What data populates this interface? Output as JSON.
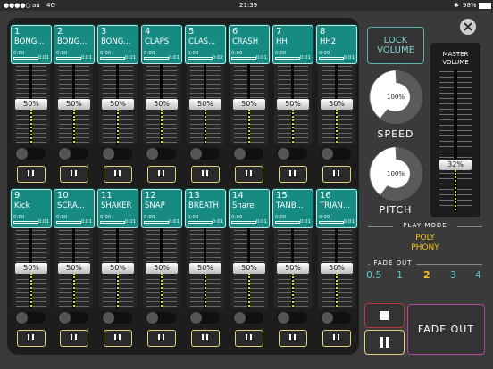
{
  "status": {
    "carrier": "au",
    "network": "4G",
    "time": "21:39",
    "battery": "98%"
  },
  "channels": [
    {
      "num": "1",
      "name": "BONG...",
      "pos": "0:00",
      "len": "0:01",
      "level": "50%",
      "level_frac": 0.5
    },
    {
      "num": "2",
      "name": "BONG...",
      "pos": "0:00",
      "len": "0:01",
      "level": "50%",
      "level_frac": 0.5
    },
    {
      "num": "3",
      "name": "BONG...",
      "pos": "0:00",
      "len": "0:01",
      "level": "50%",
      "level_frac": 0.5
    },
    {
      "num": "4",
      "name": "CLAPS",
      "pos": "0:00",
      "len": "0:01",
      "level": "50%",
      "level_frac": 0.5
    },
    {
      "num": "5",
      "name": "CLAS...",
      "pos": "0:00",
      "len": "0:02",
      "level": "50%",
      "level_frac": 0.5
    },
    {
      "num": "6",
      "name": "CRASH",
      "pos": "0:00",
      "len": "0:01",
      "level": "50%",
      "level_frac": 0.5
    },
    {
      "num": "7",
      "name": "HH",
      "pos": "0:00",
      "len": "0:01",
      "level": "50%",
      "level_frac": 0.5
    },
    {
      "num": "8",
      "name": "HH2",
      "pos": "0:00",
      "len": "0:01",
      "level": "50%",
      "level_frac": 0.5
    },
    {
      "num": "9",
      "name": "Kick",
      "pos": "0:00",
      "len": "0:01",
      "level": "50%",
      "level_frac": 0.5
    },
    {
      "num": "10",
      "name": "SCRA...",
      "pos": "0:00",
      "len": "0:01",
      "level": "50%",
      "level_frac": 0.5
    },
    {
      "num": "11",
      "name": "SHAKER",
      "pos": "0:00",
      "len": "0:01",
      "level": "50%",
      "level_frac": 0.5
    },
    {
      "num": "12",
      "name": "SNAP",
      "pos": "0:00",
      "len": "0:01",
      "level": "50%",
      "level_frac": 0.5
    },
    {
      "num": "13",
      "name": "BREATH",
      "pos": "0:00",
      "len": "0:01",
      "level": "50%",
      "level_frac": 0.5
    },
    {
      "num": "14",
      "name": "Snare",
      "pos": "0:00",
      "len": "0:01",
      "level": "50%",
      "level_frac": 0.5
    },
    {
      "num": "15",
      "name": "TANB...",
      "pos": "0:00",
      "len": "0:01",
      "level": "50%",
      "level_frac": 0.5
    },
    {
      "num": "16",
      "name": "TRIAN...",
      "pos": "0:00",
      "len": "0:01",
      "level": "50%",
      "level_frac": 0.5
    }
  ],
  "controls": {
    "lock_line1": "LOCK",
    "lock_line2": "VOLUME",
    "speed_value": "100%",
    "speed_label": "SPEED",
    "pitch_value": "100%",
    "pitch_label": "PITCH",
    "master_line1": "MASTER",
    "master_line2": "VOLUME",
    "master_level": "32%",
    "master_level_frac": 0.32,
    "play_mode_label": "PLAY MODE",
    "play_mode_line1": "POLY",
    "play_mode_line2": "PHONY",
    "fade_out_label": "FADE OUT",
    "fade_options": [
      "0.5",
      "1",
      "2",
      "3",
      "4"
    ],
    "fade_selected": "2",
    "fade_out_button": "FADE OUT"
  },
  "colors": {
    "pad": "#178a82",
    "accent_yellow": "#e3d173",
    "selected_yellow": "#f0c419",
    "fade_border": "#b0459e",
    "stop_border": "#b23a3a",
    "lock_border": "#55b5ad"
  }
}
